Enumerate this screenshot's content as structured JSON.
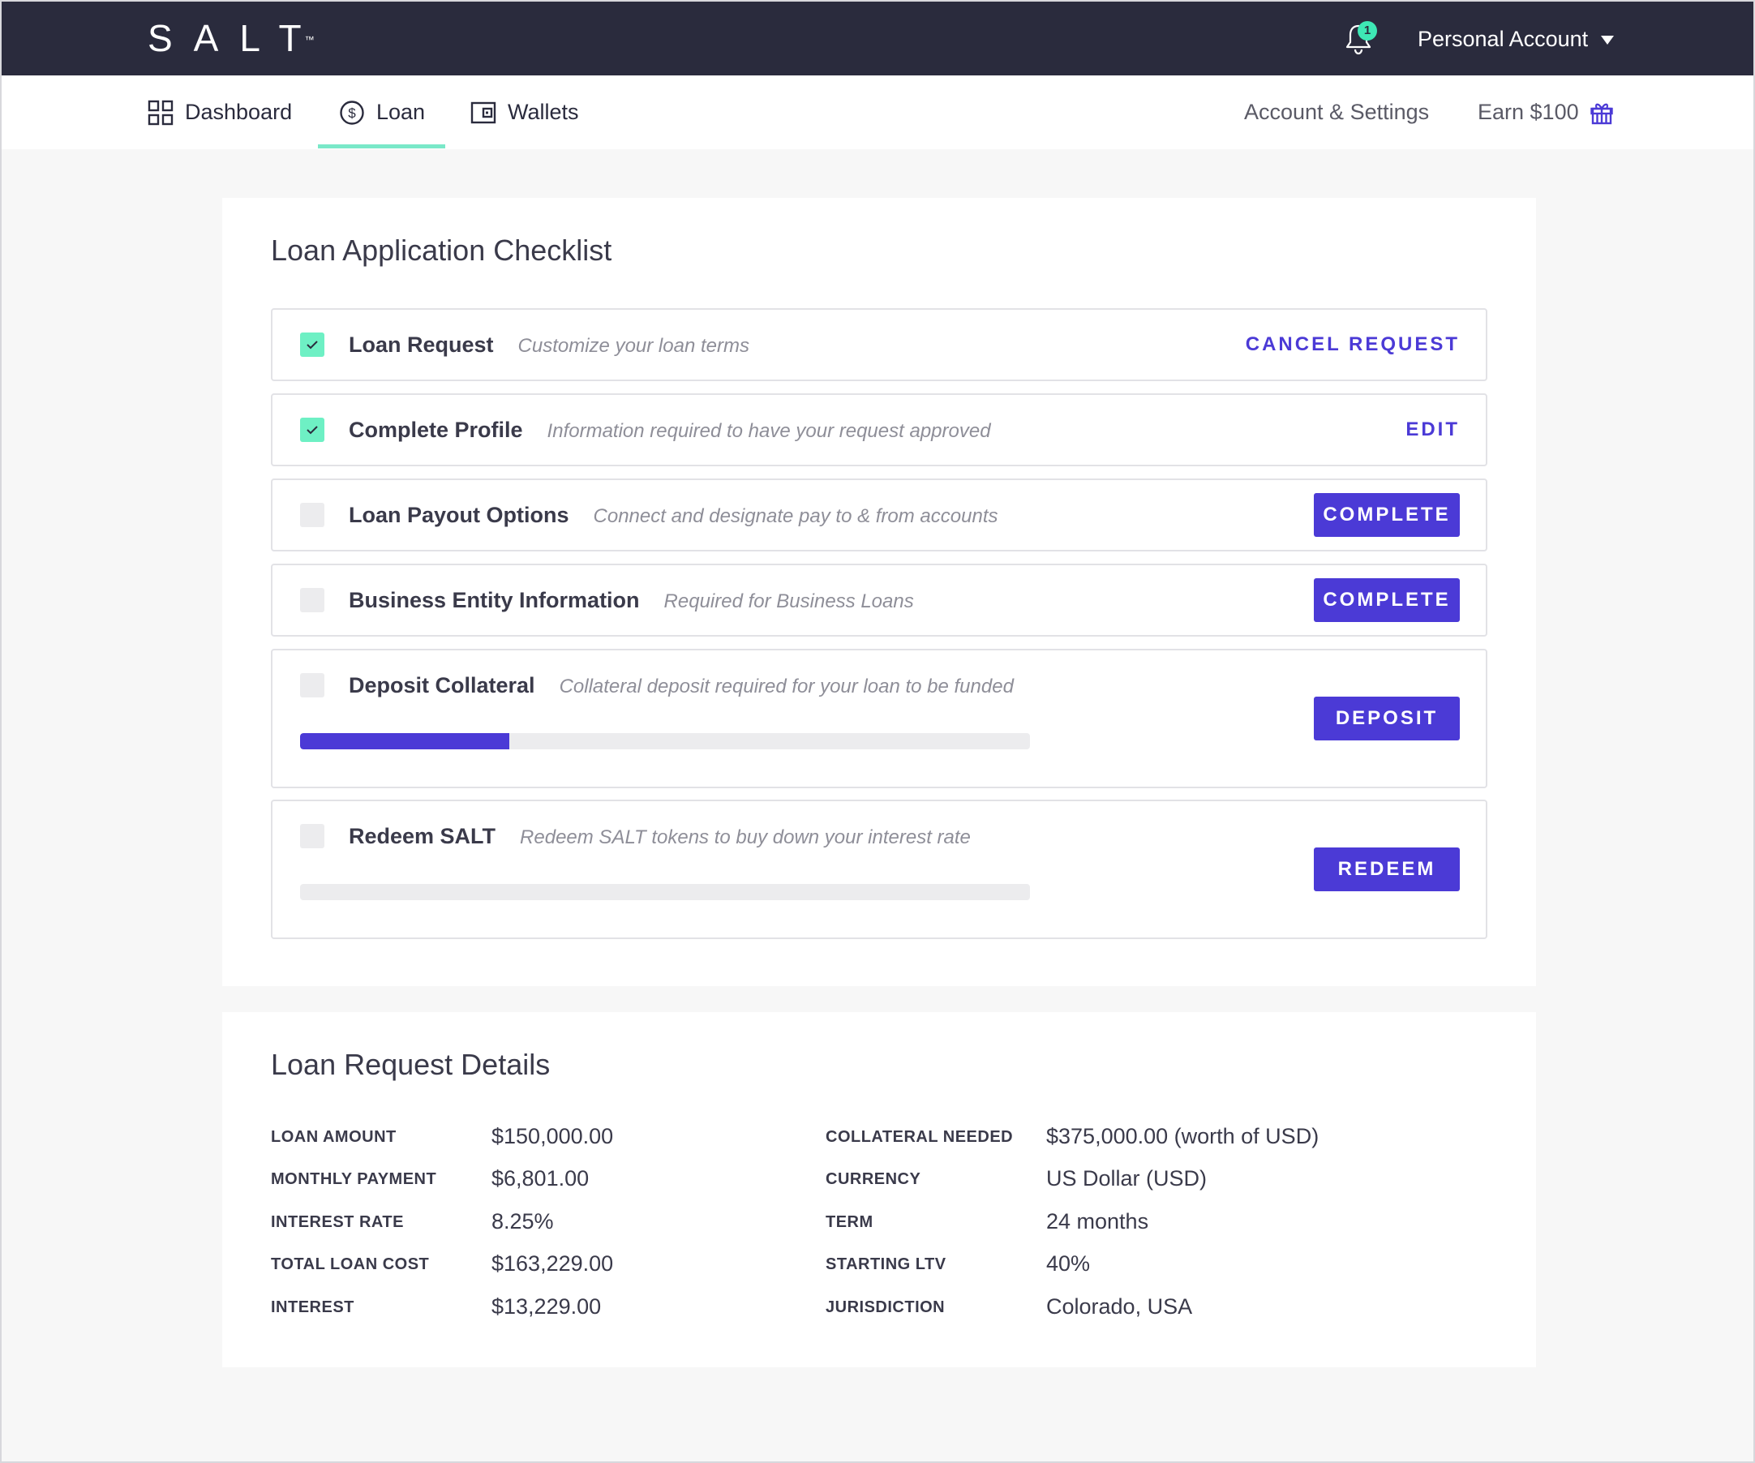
{
  "header": {
    "logo": "SALT",
    "logo_tm": "™",
    "notification_count": "1",
    "account_label": "Personal Account"
  },
  "nav": {
    "dashboard": "Dashboard",
    "loan": "Loan",
    "wallets": "Wallets",
    "account_settings": "Account & Settings",
    "earn": "Earn $100"
  },
  "checklist": {
    "title": "Loan Application Checklist",
    "items": [
      {
        "title": "Loan Request",
        "desc": "Customize your loan terms",
        "action": "CANCEL REQUEST",
        "done": true
      },
      {
        "title": "Complete Profile",
        "desc": "Information required to have your request approved",
        "action": "EDIT",
        "done": true
      },
      {
        "title": "Loan Payout Options",
        "desc": "Connect and designate pay to & from accounts",
        "action": "COMPLETE",
        "done": false
      },
      {
        "title": "Business Entity Information",
        "desc": "Required for Business Loans",
        "action": "COMPLETE",
        "done": false
      },
      {
        "title": "Deposit Collateral",
        "desc": "Collateral deposit required for your loan to be funded",
        "action": "DEPOSIT",
        "done": false,
        "progress": 0.287
      },
      {
        "title": "Redeem SALT",
        "desc": "Redeem SALT tokens to buy down your interest rate",
        "action": "REDEEM",
        "done": false,
        "progress": 0
      }
    ]
  },
  "details": {
    "title": "Loan Request Details",
    "left": [
      {
        "label": "LOAN AMOUNT",
        "value": "$150,000.00"
      },
      {
        "label": "MONTHLY PAYMENT",
        "value": "$6,801.00"
      },
      {
        "label": "INTEREST RATE",
        "value": "8.25%"
      },
      {
        "label": "TOTAL LOAN COST",
        "value": "$163,229.00"
      },
      {
        "label": "INTEREST",
        "value": "$13,229.00"
      }
    ],
    "right": [
      {
        "label": "COLLATERAL NEEDED",
        "value": "$375,000.00 (worth of USD)"
      },
      {
        "label": "CURRENCY",
        "value": "US Dollar (USD)"
      },
      {
        "label": "TERM",
        "value": "24 months"
      },
      {
        "label": "STARTING LTV",
        "value": "40%"
      },
      {
        "label": "JURISDICTION",
        "value": "Colorado, USA"
      }
    ]
  },
  "colors": {
    "header_bg": "#2a2b3d",
    "accent": "#4b3ad6",
    "check_green": "#6ef0c4",
    "tab_underline": "#7ae8c8"
  }
}
